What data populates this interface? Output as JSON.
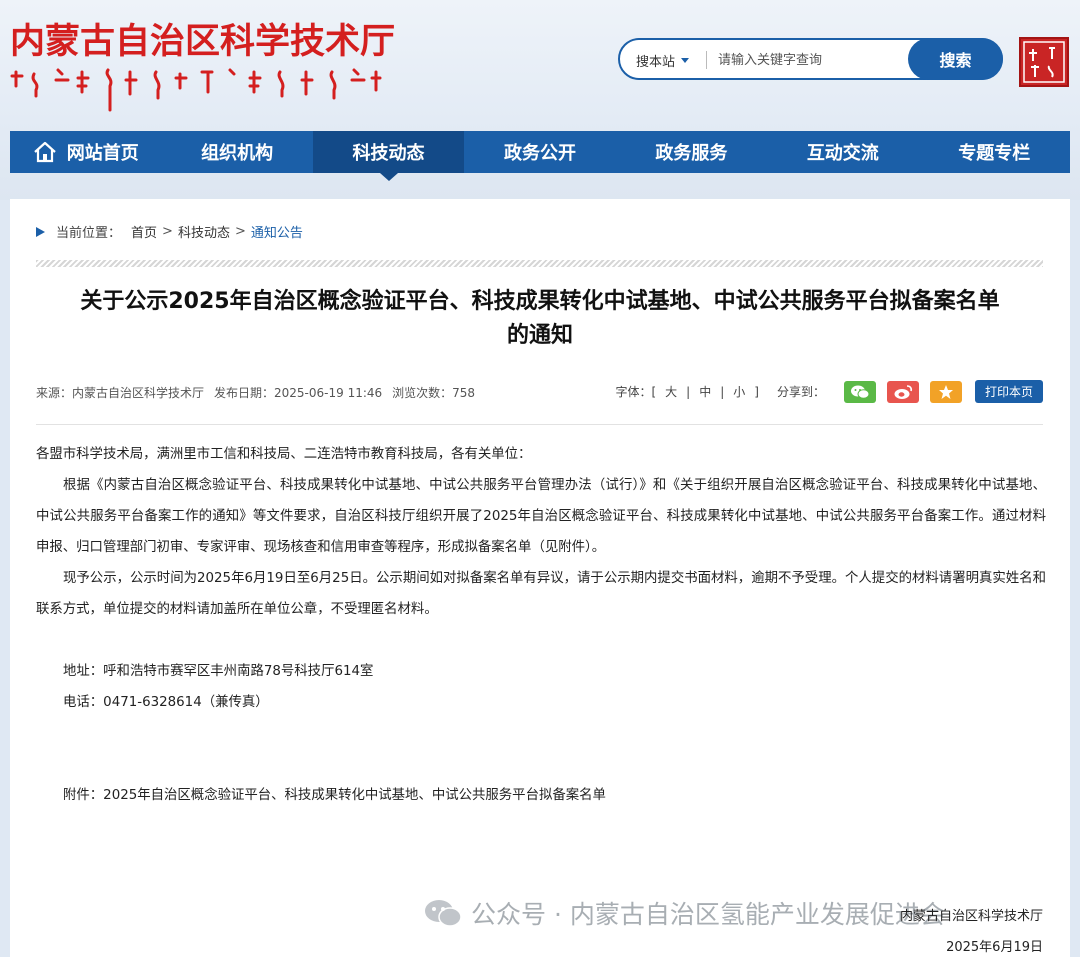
{
  "header": {
    "site_title": "内蒙古自治区科学技术厅",
    "search": {
      "scope_label": "搜本站",
      "placeholder": "请输入关键字查询",
      "button_label": "搜索"
    }
  },
  "nav": {
    "items": [
      {
        "label": "网站首页",
        "icon": "home-icon"
      },
      {
        "label": "组织机构"
      },
      {
        "label": "科技动态"
      },
      {
        "label": "政务公开"
      },
      {
        "label": "政务服务"
      },
      {
        "label": "互动交流"
      },
      {
        "label": "专题专栏"
      }
    ],
    "active": "科技动态"
  },
  "breadcrumb": {
    "prefix": "当前位置：",
    "items": [
      "首页",
      "科技动态",
      "通知公告"
    ],
    "separator": ">"
  },
  "article": {
    "title_line1": "关于公示2025年自治区概念验证平台、科技成果转化中试基地、中试公共服务平台拟备案名单",
    "title_line2": "的通知",
    "meta": {
      "source": "来源：内蒙古自治区科学技术厅",
      "publish_date": "发布日期：2025-06-19 11:46",
      "views": "浏览次数：758"
    },
    "tools": {
      "font_label": "字体：",
      "font_open": "[",
      "font_close": "]",
      "font_sep": "|",
      "font_large": "大",
      "font_medium": "中",
      "font_small": "小",
      "share_label": "分享到：",
      "print_label": "打印本页"
    },
    "paragraphs": {
      "greeting": "各盟市科学技术局，满洲里市工信和科技局、二连浩特市教育科技局，各有关单位：",
      "p1": "根据《内蒙古自治区概念验证平台、科技成果转化中试基地、中试公共服务平台管理办法（试行）》和《关于组织开展自治区概念验证平台、科技成果转化中试基地、中试公共服务平台备案工作的通知》等文件要求，自治区科技厅组织开展了2025年自治区概念验证平台、科技成果转化中试基地、中试公共服务平台备案工作。通过材料申报、归口管理部门初审、专家评审、现场核查和信用审查等程序，形成拟备案名单（见附件）。",
      "p2": "现予公示，公示时间为2025年6月19日至6月25日。公示期间如对拟备案名单有异议，请于公示期内提交书面材料，逾期不予受理。个人提交的材料请署明真实姓名和联系方式，单位提交的材料请加盖所在单位公章，不受理匿名材料。",
      "address": "地址：呼和浩特市赛罕区丰州南路78号科技厅614室",
      "phone": "电话：0471-6328614（兼传真）",
      "attachment": "附件：2025年自治区概念验证平台、科技成果转化中试基地、中试公共服务平台拟备案名单"
    },
    "signature": "内蒙古自治区科学技术厅",
    "signature_date": "2025年6月19日"
  },
  "watermark": "公众号 · 内蒙古自治区氢能产业发展促进会",
  "colors": {
    "brand_blue": "#1b5fa8",
    "title_red": "#d41f1f",
    "wechat_green": "#5ab946",
    "weibo_red": "#e8554e",
    "favorite_orange": "#f2a227"
  }
}
